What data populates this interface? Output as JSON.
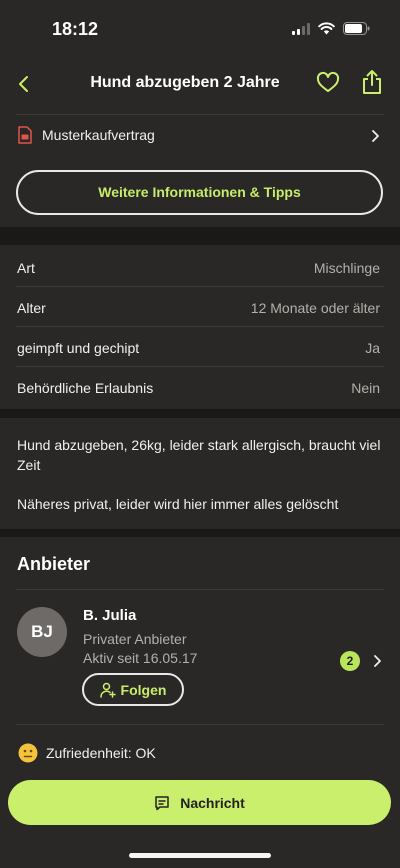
{
  "status_bar": {
    "time": "18:12",
    "signal_icon": "cellular-signal-icon",
    "wifi_icon": "wifi-icon",
    "battery_icon": "battery-icon"
  },
  "nav": {
    "title": "Hund abzugeben 2 Jahre",
    "back_icon": "chevron-left-icon",
    "favorite_icon": "heart-icon",
    "share_icon": "share-icon"
  },
  "contract": {
    "label": "Musterkaufvertrag",
    "icon": "pdf-file-icon"
  },
  "info_button": {
    "label": "Weitere Informationen & Tipps"
  },
  "attributes": [
    {
      "label": "Art",
      "value": "Mischlinge"
    },
    {
      "label": "Alter",
      "value": "12 Monate oder älter"
    },
    {
      "label": "geimpft und gechipt",
      "value": "Ja"
    },
    {
      "label": "Behördliche Erlaubnis",
      "value": "Nein"
    }
  ],
  "description": {
    "paragraph1": "Hund abzugeben, 26kg, leider stark allergisch, braucht viel Zeit",
    "paragraph2": "Näheres privat, leider wird hier immer alles gelöscht"
  },
  "seller": {
    "section_title": "Anbieter",
    "initials": "BJ",
    "name": "B. Julia",
    "type": "Privater Anbieter",
    "active_since": "Aktiv seit 16.05.17",
    "badge_count": "2",
    "follow_label": "Folgen",
    "satisfaction": "Zufriedenheit: OK"
  },
  "message_button": {
    "label": "Nachricht"
  },
  "colors": {
    "background": "#2a2826",
    "accent": "#c9ef6c",
    "accent_text": "#c6ec6a",
    "section_separator": "#1a1917",
    "pdf_icon": "#e0564a",
    "satisfaction_emoji": "#f5c23c"
  }
}
